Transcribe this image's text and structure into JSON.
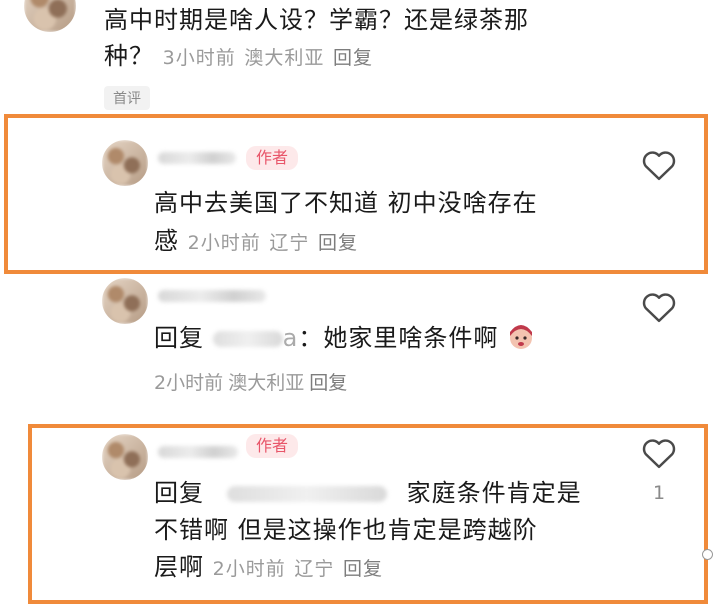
{
  "comments": [
    {
      "text_line1": "高中时期是啥人设？学霸？还是绿茶那",
      "text_line2": "种？",
      "time": "3小时前",
      "location": "澳大利亚",
      "reply_label": "回复",
      "tag": "首评"
    },
    {
      "badge": "作者",
      "text_line1": "高中去美国了不知道 初中没啥存在",
      "text_line2": "感",
      "time": "2小时前",
      "location": "辽宁",
      "reply_label": "回复"
    },
    {
      "reply_prefix": "回复",
      "name_suffix": "a",
      "text": "：她家里啥条件啊",
      "time": "2小时前",
      "location": "澳大利亚",
      "reply_label": "回复"
    },
    {
      "badge": "作者",
      "reply_prefix": "回复",
      "text_line1": "家庭条件肯定是",
      "text_line2": "不错啊 但是这操作也肯定是跨越阶",
      "text_line3": "层啊",
      "time": "2小时前",
      "location": "辽宁",
      "reply_label": "回复",
      "like_count": "1"
    }
  ],
  "colors": {
    "highlight": "#f08a3a",
    "author_badge_bg": "#fde9ea",
    "author_badge_text": "#e8566a"
  },
  "icons": [
    "heart-icon",
    "emoji-face-icon"
  ]
}
